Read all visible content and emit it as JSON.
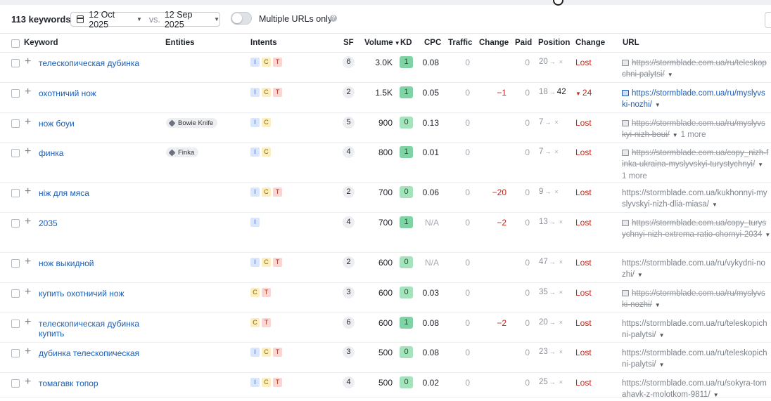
{
  "toolbar": {
    "keyword_count": "113 keywords",
    "date_primary": "12 Oct 2025",
    "vs": "vs.",
    "date_compare": "12 Sep 2025",
    "toggle_label": "Multiple URLs only",
    "help": "?"
  },
  "columns": {
    "keyword": "Keyword",
    "entities": "Entities",
    "intents": "Intents",
    "sf": "SF",
    "volume": "Volume",
    "kd": "KD",
    "cpc": "CPC",
    "traffic": "Traffic",
    "change": "Change",
    "paid": "Paid",
    "position": "Position",
    "change2": "Change",
    "url": "URL"
  },
  "colors": {
    "kd_green": "#7fd3a4",
    "kd_green_light": "#a5e3bd",
    "link": "#1b5eb5",
    "lost": "#c0271b"
  },
  "rows": [
    {
      "keyword": "телескопическая дубинка",
      "entity": "",
      "intents": [
        "I",
        "C",
        "T"
      ],
      "sf": "6",
      "volume": "3.0K",
      "kd": "1",
      "cpc": "0.08",
      "traffic": "0",
      "change": "",
      "paid": "0",
      "pos_from": "20",
      "pos_to": "×",
      "change2": "Lost",
      "url": "https://stormblade.com.ua/ru/teleskopichni-palytsi/",
      "url_display_1": "https://stormblade.com.ua/ru/teleskop",
      "url_display_2": "chni-palytsi/",
      "url_state": "lost",
      "more": ""
    },
    {
      "keyword": "охотничий нож",
      "entity": "",
      "intents": [
        "I",
        "C",
        "T"
      ],
      "sf": "2",
      "volume": "1.5K",
      "kd": "1",
      "cpc": "0.05",
      "traffic": "0",
      "change": "−1",
      "paid": "0",
      "pos_from": "18",
      "pos_to": "42",
      "change2": "24",
      "url": "https://stormblade.com.ua/ru/myslyvski-nozhi/",
      "url_display_1": "https://stormblade.com.ua/ru/myslyvs",
      "url_display_2": "ki-nozhi/",
      "url_state": "active",
      "more": ""
    },
    {
      "keyword": "нож боуи",
      "entity": "Bowie Knife",
      "intents": [
        "I",
        "C"
      ],
      "sf": "5",
      "volume": "900",
      "kd": "0",
      "cpc": "0.13",
      "traffic": "0",
      "change": "",
      "paid": "0",
      "pos_from": "7",
      "pos_to": "×",
      "change2": "Lost",
      "url": "https://stormblade.com.ua/ru/myslyvskyi-nizh-boui/",
      "url_display_1": "https://stormblade.com.ua/ru/myslyvs",
      "url_display_2": "kyi-nizh-boui/",
      "url_state": "lost",
      "more": "1 more"
    },
    {
      "keyword": "финка",
      "entity": "Finka",
      "intents": [
        "I",
        "C"
      ],
      "sf": "4",
      "volume": "800",
      "kd": "1",
      "cpc": "0.01",
      "traffic": "0",
      "change": "",
      "paid": "0",
      "pos_from": "7",
      "pos_to": "×",
      "change2": "Lost",
      "url": "https://stormblade.com.ua/copy_nizh-finka-ukraina-myslyvskyi-turystychnyi/",
      "url_display_1": "https://stormblade.com.ua/copy_nizh-f",
      "url_display_2": "inka-ukraina-myslyvskyi-turystychnyi/",
      "url_state": "lost",
      "more": "1 more"
    },
    {
      "keyword": "ніж для мяса",
      "entity": "",
      "intents": [
        "I",
        "C",
        "T"
      ],
      "sf": "2",
      "volume": "700",
      "kd": "0",
      "cpc": "0.06",
      "traffic": "0",
      "change": "−20",
      "paid": "0",
      "pos_from": "9",
      "pos_to": "×",
      "change2": "Lost",
      "url": "https://stormblade.com.ua/kukhonnyi-myslyvskyi-nizh-dlia-miasa/",
      "url_display_1": "https://stormblade.com.ua/kukhonnyi-my",
      "url_display_2": "slyvskyi-nizh-dlia-miasa/",
      "url_state": "plain",
      "more": ""
    },
    {
      "keyword": "2035",
      "entity": "",
      "intents": [
        "I"
      ],
      "sf": "4",
      "volume": "700",
      "kd": "1",
      "cpc": "N/A",
      "traffic": "0",
      "change": "−2",
      "paid": "0",
      "pos_from": "13",
      "pos_to": "×",
      "change2": "Lost",
      "url": "https://stormblade.com.ua/copy_turystychnyi-nizh-extrema-ratio-chornyi-2034",
      "url_display_1": "https://stormblade.com.ua/copy_turys",
      "url_display_2": "ychnyi-nizh-extrema-ratio-chornyi-2034",
      "url_state": "lost",
      "more": ""
    },
    {
      "keyword": "нож выкидной",
      "entity": "",
      "intents": [
        "I",
        "C",
        "T"
      ],
      "sf": "2",
      "volume": "600",
      "kd": "0",
      "cpc": "N/A",
      "traffic": "0",
      "change": "",
      "paid": "0",
      "pos_from": "47",
      "pos_to": "×",
      "change2": "Lost",
      "url": "https://stormblade.com.ua/ru/vykydni-nozhi/",
      "url_display_1": "https://stormblade.com.ua/ru/vykydni-no",
      "url_display_2": "zhi/",
      "url_state": "plain",
      "more": ""
    },
    {
      "keyword": "купить охотничий нож",
      "entity": "",
      "intents": [
        "C",
        "T"
      ],
      "sf": "3",
      "volume": "600",
      "kd": "0",
      "cpc": "0.03",
      "traffic": "0",
      "change": "",
      "paid": "0",
      "pos_from": "35",
      "pos_to": "×",
      "change2": "Lost",
      "url": "https://stormblade.com.ua/ru/myslyvski-nozhi/",
      "url_display_1": "https://stormblade.com.ua/ru/myslyvs",
      "url_display_2": "ki-nozhi/",
      "url_state": "lost",
      "more": ""
    },
    {
      "keyword": "телескопическая дубинка купить",
      "entity": "",
      "intents": [
        "C",
        "T"
      ],
      "sf": "6",
      "volume": "600",
      "kd": "1",
      "cpc": "0.08",
      "traffic": "0",
      "change": "−2",
      "paid": "0",
      "pos_from": "20",
      "pos_to": "×",
      "change2": "Lost",
      "url": "https://stormblade.com.ua/ru/teleskopichni-palytsi/",
      "url_display_1": "https://stormblade.com.ua/ru/teleskopich",
      "url_display_2": "ni-palytsi/",
      "url_state": "plain",
      "more": ""
    },
    {
      "keyword": "дубинка телескопическая",
      "entity": "",
      "intents": [
        "I",
        "C",
        "T"
      ],
      "sf": "3",
      "volume": "500",
      "kd": "0",
      "cpc": "0.08",
      "traffic": "0",
      "change": "",
      "paid": "0",
      "pos_from": "23",
      "pos_to": "×",
      "change2": "Lost",
      "url": "https://stormblade.com.ua/ru/teleskopichni-palytsi/",
      "url_display_1": "https://stormblade.com.ua/ru/teleskopich",
      "url_display_2": "ni-palytsi/",
      "url_state": "plain",
      "more": ""
    },
    {
      "keyword": "томагавк топор",
      "entity": "",
      "intents": [
        "I",
        "C",
        "T"
      ],
      "sf": "4",
      "volume": "500",
      "kd": "0",
      "cpc": "0.02",
      "traffic": "0",
      "change": "",
      "paid": "0",
      "pos_from": "25",
      "pos_to": "×",
      "change2": "Lost",
      "url": "https://stormblade.com.ua/ru/sokyra-tomahavk-z-molotkom-9811/",
      "url_display_1": "https://stormblade.com.ua/ru/sokyra-tom",
      "url_display_2": "ahavk-z-molotkom-9811/",
      "url_state": "plain",
      "more": ""
    }
  ]
}
